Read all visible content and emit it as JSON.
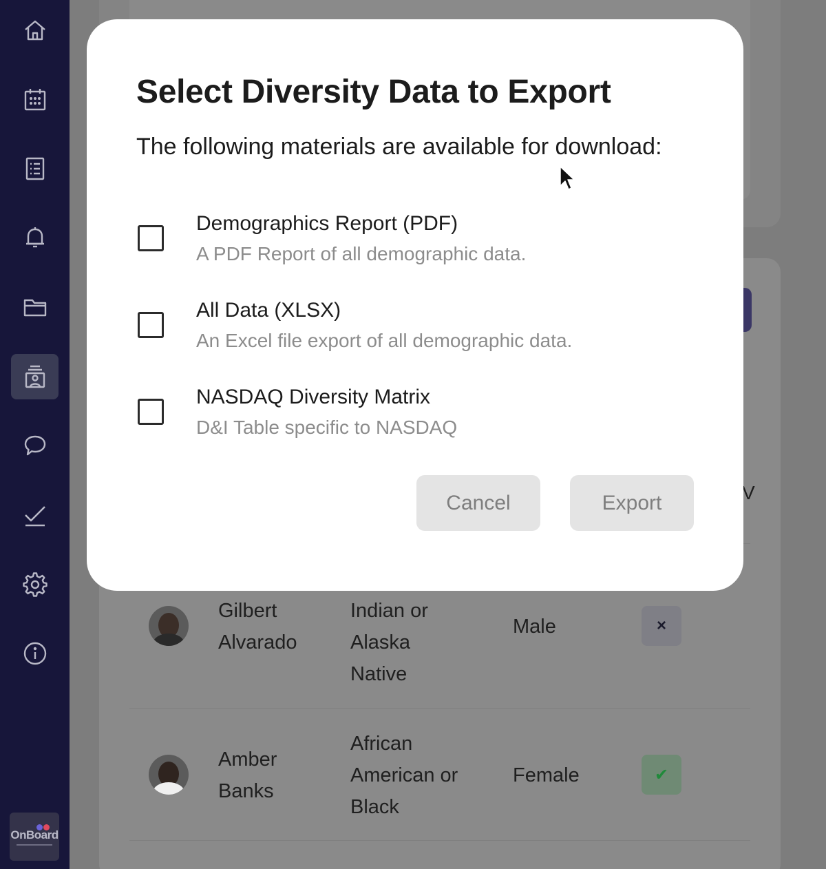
{
  "sidebar": {
    "items": [
      {
        "icon": "home-icon"
      },
      {
        "icon": "calendar-icon"
      },
      {
        "icon": "list-icon"
      },
      {
        "icon": "bell-icon"
      },
      {
        "icon": "folder-icon"
      },
      {
        "icon": "directory-icon",
        "active": true
      },
      {
        "icon": "chat-bubble-icon"
      },
      {
        "icon": "checkmark-icon"
      },
      {
        "icon": "gear-icon"
      },
      {
        "icon": "info-icon"
      }
    ],
    "logo_text": "OnBoard"
  },
  "background_table": {
    "header_fragment": "V",
    "rows": [
      {
        "name_line1": "Gilbert",
        "name_line2": "Alvarado",
        "race": [
          "Indian or",
          "Alaska",
          "Native"
        ],
        "gender": "Male",
        "status": "×"
      },
      {
        "name_line1": "Amber",
        "name_line2": "Banks",
        "race": [
          "African",
          "American or",
          "Black"
        ],
        "gender": "Female",
        "status": "✔"
      }
    ]
  },
  "modal": {
    "title": "Select Diversity Data to Export",
    "subtitle": "The following materials are available for download:",
    "options": [
      {
        "title": "Demographics Report (PDF)",
        "description": "A PDF Report of all demographic data.",
        "checked": false
      },
      {
        "title": "All Data (XLSX)",
        "description": "An Excel file export of all demographic data.",
        "checked": false
      },
      {
        "title": "NASDAQ Diversity Matrix",
        "description": "D&I Table specific to NASDAQ",
        "checked": false
      }
    ],
    "cancel_label": "Cancel",
    "export_label": "Export"
  },
  "colors": {
    "sidebar_bg": "#17163a",
    "active_nav_bg": "#3a3c55",
    "button_disabled_bg": "#e4e4e4",
    "button_disabled_text": "#7e7e7e"
  }
}
